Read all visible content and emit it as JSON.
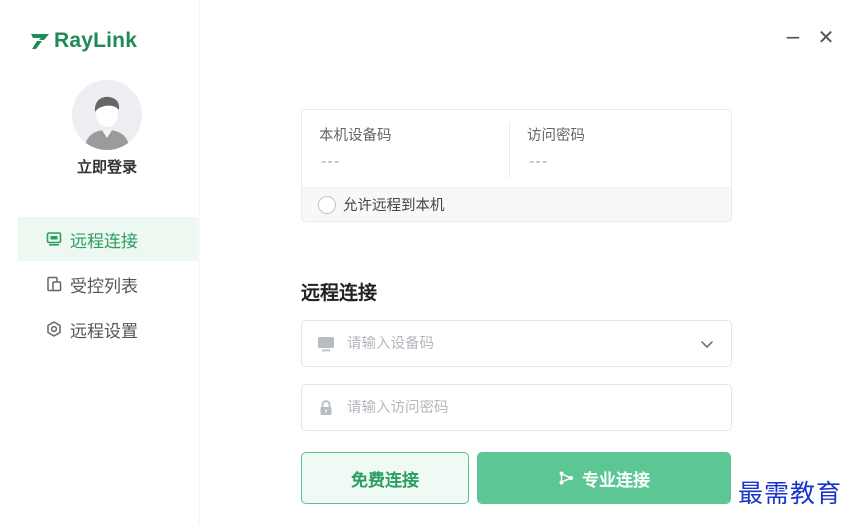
{
  "app": {
    "brand": "RayLink",
    "brand_color": "#1e8b55",
    "accent_color": "#5dc695"
  },
  "sidebar": {
    "login_label": "立即登录",
    "items": [
      {
        "label": "远程连接",
        "icon": "monitor-icon",
        "active": true
      },
      {
        "label": "受控列表",
        "icon": "device-list-icon",
        "active": false
      },
      {
        "label": "远程设置",
        "icon": "settings-icon",
        "active": false
      }
    ]
  },
  "window_controls": {
    "minimize_glyph": "−",
    "close_glyph": "✕"
  },
  "device_card": {
    "device_code_label": "本机设备码",
    "device_code_value": "---",
    "password_label": "访问密码",
    "password_value": "---",
    "allow_remote_label": "允许远程到本机",
    "allow_remote_checked": false
  },
  "remote": {
    "title": "远程连接",
    "device_input": {
      "placeholder": "请输入设备码",
      "value": "",
      "icon": "monitor-icon"
    },
    "password_input": {
      "placeholder": "请输入访问密码",
      "value": "",
      "icon": "lock-icon"
    },
    "free_connect_label": "免费连接",
    "pro_connect_label": "专业连接",
    "pro_icon": "connect-nodes-icon"
  },
  "watermark": {
    "text": "最需教育",
    "color": "#1a35c9"
  }
}
